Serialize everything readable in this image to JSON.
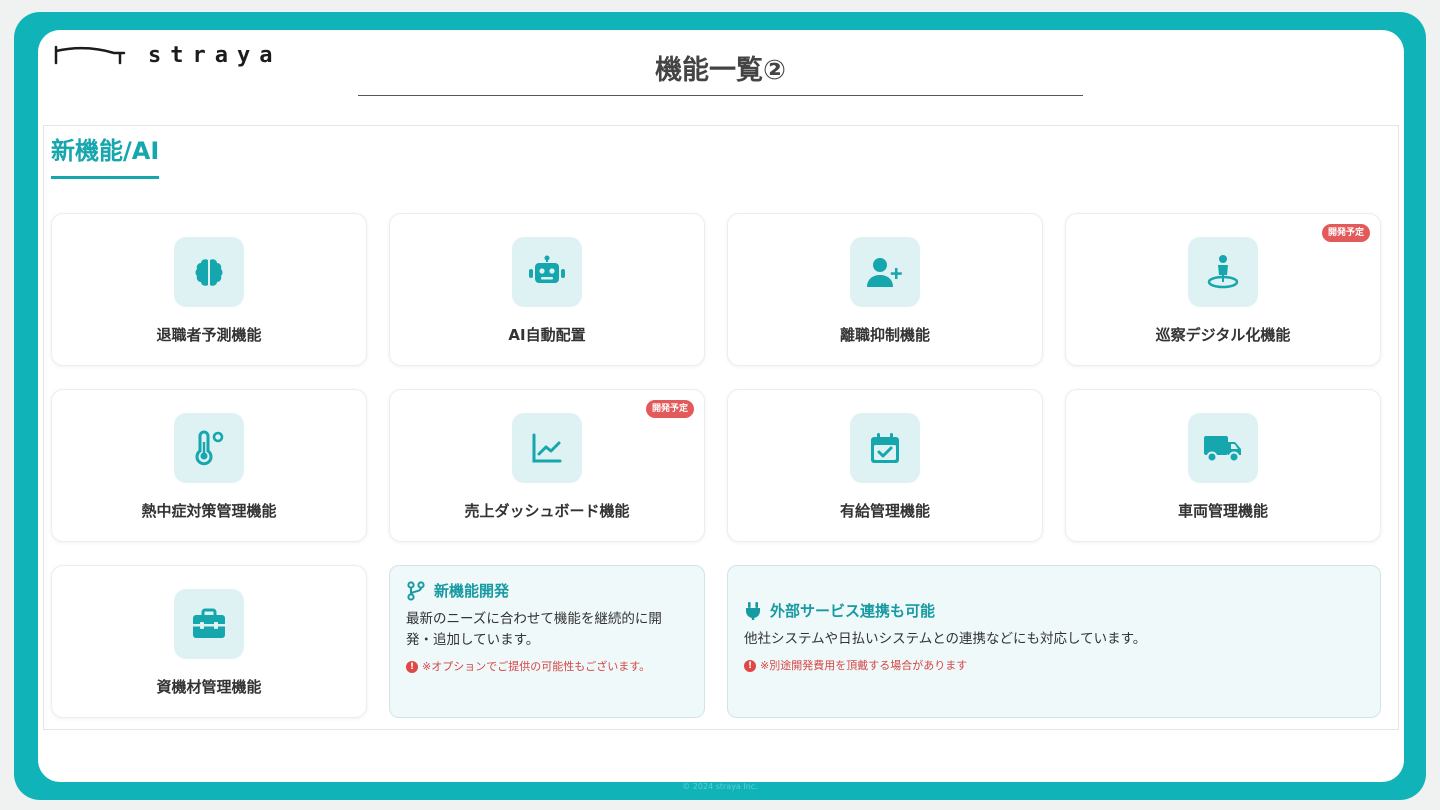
{
  "brand": {
    "name": "straya",
    "logo_icon": "bracket-line-logo"
  },
  "header": {
    "title": "機能一覧②"
  },
  "section": {
    "title": "新機能/AI"
  },
  "colors": {
    "accent": "#16a6ad",
    "frame": "#10b4b8",
    "tile": "#def2f3",
    "badge": "#e25a5a"
  },
  "cards": [
    {
      "label": "退職者予測機能",
      "icon": "brain-icon",
      "badge": ""
    },
    {
      "label": "AI自動配置",
      "icon": "robot-icon",
      "badge": ""
    },
    {
      "label": "離職抑制機能",
      "icon": "user-plus-icon",
      "badge": ""
    },
    {
      "label": "巡察デジタル化機能",
      "icon": "location-person-icon",
      "badge": "開発予定"
    },
    {
      "label": "熱中症対策管理機能",
      "icon": "thermometer-icon",
      "badge": ""
    },
    {
      "label": "売上ダッシュボード機能",
      "icon": "line-chart-icon",
      "badge": "開発予定"
    },
    {
      "label": "有給管理機能",
      "icon": "calendar-check-icon",
      "badge": ""
    },
    {
      "label": "車両管理機能",
      "icon": "truck-icon",
      "badge": ""
    },
    {
      "label": "資機材管理機能",
      "icon": "toolbox-icon",
      "badge": ""
    }
  ],
  "info_dev": {
    "title": "新機能開発",
    "icon": "branch-icon",
    "body": "最新のニーズに合わせて機能を継続的に開発・追加しています。",
    "note": "※オプションでご提供の可能性もございます。"
  },
  "info_ext": {
    "title": "外部サービス連携も可能",
    "icon": "plug-icon",
    "body": "他社システムや日払いシステムとの連携などにも対応しています。",
    "note": "※別途開発費用を頂戴する場合があります"
  },
  "footer": {
    "copyright": "© 2024 straya Inc."
  }
}
